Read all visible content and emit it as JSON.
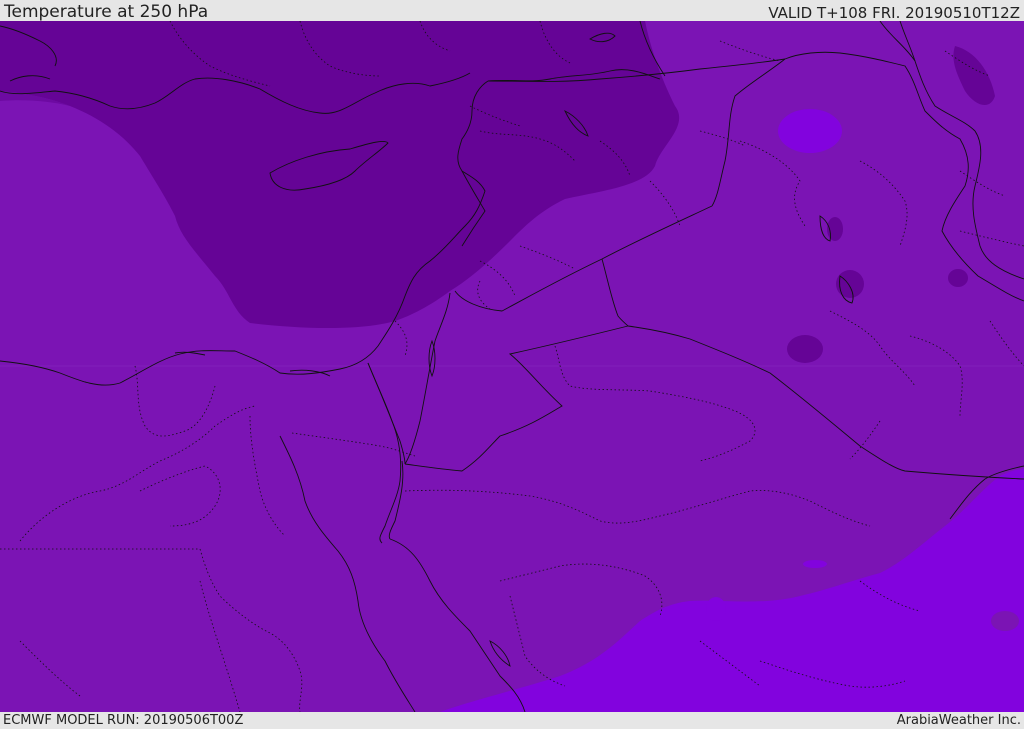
{
  "header": {
    "title": "Temperature at 250 hPa",
    "valid": "VALID T+108 FRI. 20190510T12Z"
  },
  "footer": {
    "model_run": "ECMWF MODEL RUN: 20190506T00Z",
    "credit": "ArabiaWeather Inc."
  },
  "colors": {
    "base": "#7b14b4",
    "cold": "#650496",
    "warm": "#8203de",
    "border": "#111111",
    "bar": "#e6e6e6"
  }
}
